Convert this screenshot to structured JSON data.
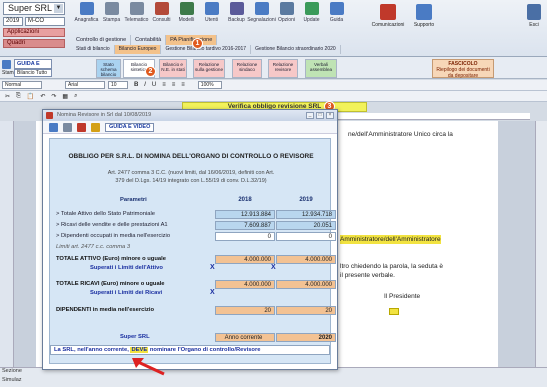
{
  "ribbon": {
    "company": "Super SRL",
    "year": "2019",
    "code": "M-CO",
    "side_buttons": [
      "Applicazioni",
      "Quadri"
    ],
    "tools": [
      {
        "label": "Anagrafica",
        "color": "#4a7bc4"
      },
      {
        "label": "Stampa",
        "color": "#7a8aa0"
      },
      {
        "label": "Telematico",
        "color": "#7a8aa0"
      },
      {
        "label": "Consulti",
        "color": "#b34a3a"
      },
      {
        "label": "Modelli",
        "color": "#3d7a4a"
      },
      {
        "label": "Utenti",
        "color": "#4a7bc4"
      },
      {
        "label": "Backup",
        "color": "#5a5a9a"
      },
      {
        "label": "Segnalazioni",
        "color": "#4a7bc4"
      },
      {
        "label": "Opzioni",
        "color": "#5a7aa0"
      },
      {
        "label": "Update",
        "color": "#3a9a5a"
      },
      {
        "label": "Guida",
        "color": "#4a7bc4"
      }
    ],
    "tabs": [
      "Controllo di gestione",
      "Contabilità",
      "PA Pianificazione"
    ],
    "subtabs": [
      "Stati di bilancio",
      "Bilancio Europeo",
      "Gestione Bilancio tardivo 2016-2017",
      "Gestione Bilancio straordinario 2020"
    ],
    "right_buttons": [
      {
        "label": "Comunicazioni",
        "color": "#c0392b"
      },
      {
        "label": "Supporto",
        "color": "#4a7bc4"
      }
    ],
    "exit_label": "Esci",
    "badges": [
      "1",
      "2",
      "3"
    ]
  },
  "toolbar2": {
    "guida": "GUIDA E VIDEO",
    "closed_label": "Bilancio Tutto",
    "stampa": "Stampa",
    "groups": [
      "Stato schema bilancio",
      "Bilancio sintetico",
      "Bilancio e N.E. in stati",
      "Relazione sulla gestione",
      "Relazione sindaco",
      "Relazione revisore",
      "Verbali assemblea"
    ],
    "fascicolo_title": "FASCICOLO",
    "fascicolo_sub": "Riepilogo dei documenti da depositare"
  },
  "format": {
    "style": "Normal",
    "font": "Arial",
    "size": "10",
    "zoom": "100%"
  },
  "verifica": "Verifica obbligo revisione SRL",
  "document": {
    "line1": "ne/dell'Amministratore Unico circa la",
    "highlight_line": "Amministratore/dell'Amministratore",
    "line3": "ltro chiedendo la parola, la seduta è",
    "line4": "il presente verbale.",
    "presidente": "Il Presidente"
  },
  "bottom": {
    "sezione": "Sezione",
    "simulazione": "Simulaz"
  },
  "dialog": {
    "title": "Nomina Revisore in Srl dal 10/08/2019",
    "guida": "GUIDA E VIDEO",
    "heading": "OBBLIGO PER S.R.L. DI NOMINA DELL'ORGANO DI CONTROLLO O REVISORE",
    "note1": "Art. 2477 comma 3 C.C. (nuovi limiti, dal 16/06/2019, definiti con Art.",
    "note2": "379 del D.Lgs. 14/19 integrato con L.55/19 di conv. D.L.32/19)",
    "param_label": "Parametri",
    "col_2018": "2018",
    "col_2019": "2019",
    "rows": {
      "attivo_label": "> Totale Attivo dello Stato Patrimoniale",
      "attivo_2018": "12.913.884",
      "attivo_2019": "12.934.718",
      "ricavi_label": "> Ricavi delle vendite e delle prestazioni A1",
      "ricavi_2018": "7.609.887",
      "ricavi_2019": "20.051",
      "dip_label": "> Dipendenti occupati in media nell'esercizio",
      "dip_2018": "0",
      "dip_2019": "0",
      "limiti_label": "Limiti art. 2477 c.c. comma 3",
      "tot_attivo_label": "TOTALE ATTIVO (Euro) minore o uguale",
      "tot_attivo_2018": "4.000.000",
      "tot_attivo_2019": "4.000.000",
      "sup_attivo_label": "Superati i Limiti dell'Attivo",
      "tot_ricavi_label": "TOTALE RICAVI (Euro) minore o uguale",
      "tot_ricavi_2018": "4.000.000",
      "tot_ricavi_2019": "4.000.000",
      "sup_ricavi_label": "Superati i Limiti dei Ricavi",
      "dip_media_label": "DIPENDENTI in media nell'esercizio",
      "dip_media_2018": "20",
      "dip_media_2019": "20",
      "x_mark": "X"
    },
    "company": "Super SRL",
    "anno_label": "Anno corrente",
    "anno_value": "2020",
    "result_pre": "La SRL, nell'anno corrente,",
    "result_deve": "DEVE",
    "result_post": "nominare l'Organo di controllo/Revisore"
  }
}
